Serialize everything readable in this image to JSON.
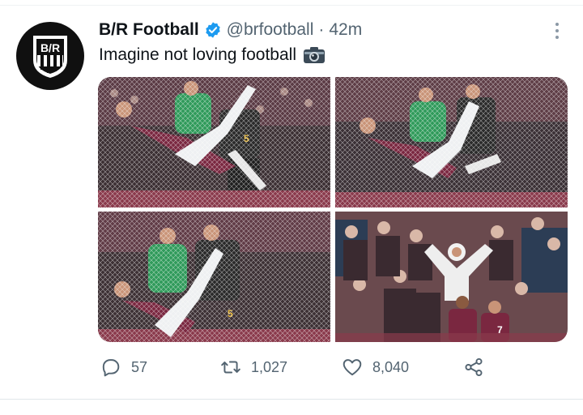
{
  "account": {
    "name": "B/R Football",
    "handle": "@brfootball",
    "separator": "·",
    "time": "42m",
    "avatar_text": "B/R",
    "verified_icon": "verified-badge-icon"
  },
  "tweet": {
    "text": "Imagine not loving football",
    "emoji_icon": "camera-icon"
  },
  "media": {
    "photos": [
      {
        "description_icon": "photo-1"
      },
      {
        "description_icon": "photo-2"
      },
      {
        "description_icon": "photo-3"
      },
      {
        "description_icon": "photo-4"
      }
    ],
    "shirt_number": "5",
    "shirt_number_2": "7"
  },
  "actions": {
    "replies": "57",
    "retweets": "1,027",
    "likes": "8,040"
  },
  "colors": {
    "accent": "#1d9bf0",
    "secondary_text": "#536471",
    "claret": "#7a2740",
    "keeper_green": "#2f9a5a"
  }
}
